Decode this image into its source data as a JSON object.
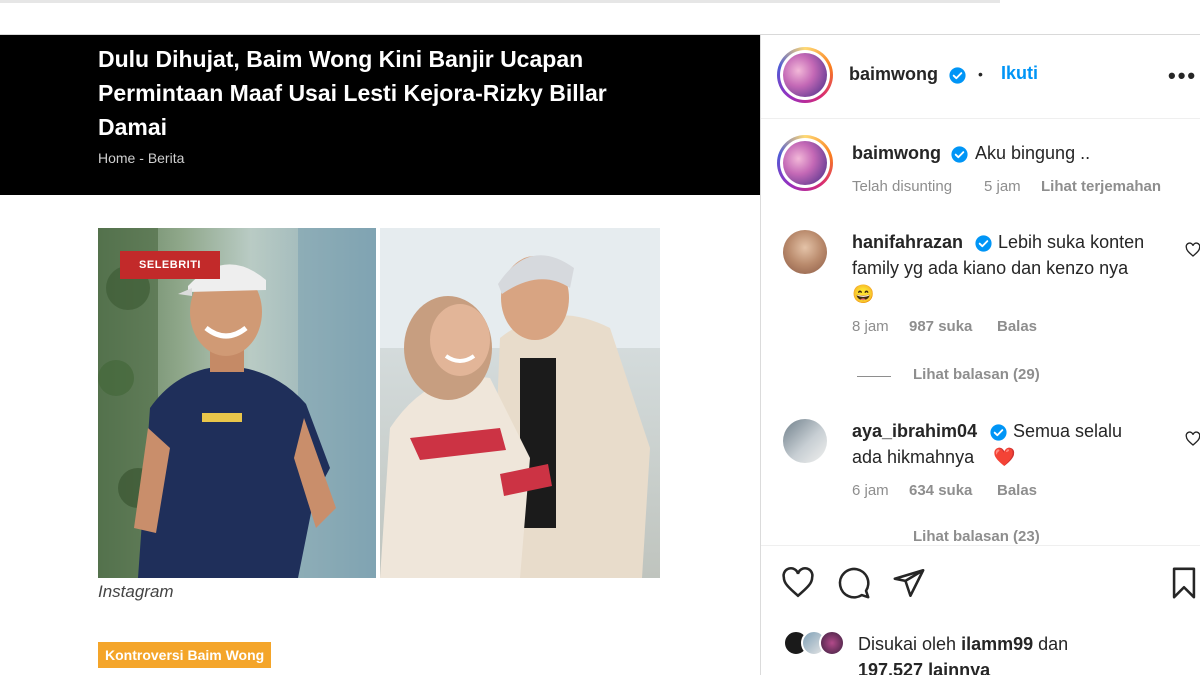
{
  "article": {
    "title": "Dulu Dihujat, Baim Wong Kini Banjir Ucapan Permintaan Maaf Usai Lesti Kejora-Rizky Billar Damai",
    "breadcrumb_home": "Home",
    "breadcrumb_sep": "-",
    "breadcrumb_section": "Berita",
    "image_badge": "SELEBRITI",
    "caption": "Instagram",
    "tag": "Kontroversi Baim Wong"
  },
  "instagram": {
    "header": {
      "username": "baimwong",
      "separator": "•",
      "follow_label": "Ikuti",
      "more_label": "•••"
    },
    "post": {
      "username": "baimwong",
      "caption": "Aku bingung ..",
      "edited": "Telah disunting",
      "time": "5 jam",
      "translate": "Lihat terjemahan"
    },
    "comments": [
      {
        "username": "hanifahrazan",
        "text_line1": "Lebih suka konten",
        "text_line2": "family yg ada kiano dan kenzo nya",
        "emoji": "😄",
        "time": "8 jam",
        "likes": "987 suka",
        "reply": "Balas",
        "view_replies": "Lihat balasan (29)"
      },
      {
        "username": "aya_ibrahim04",
        "text_line1": "Semua selalu",
        "text_line2": "ada hikmahnya",
        "emoji": "❤️",
        "time": "6 jam",
        "likes": "634 suka",
        "reply": "Balas",
        "view_replies": "Lihat balasan (23)"
      }
    ],
    "footer": {
      "liked_by_prefix": "Disukai oleh",
      "liked_by_user": "ilamm99",
      "liked_by_and": "dan",
      "liked_by_count": "197,527 lainnya"
    },
    "colors": {
      "link_blue": "#0095f6",
      "text": "#262626",
      "muted": "#8e8e8e",
      "badge_red": "#c22a2a",
      "tag_orange": "#f4a52a"
    }
  }
}
